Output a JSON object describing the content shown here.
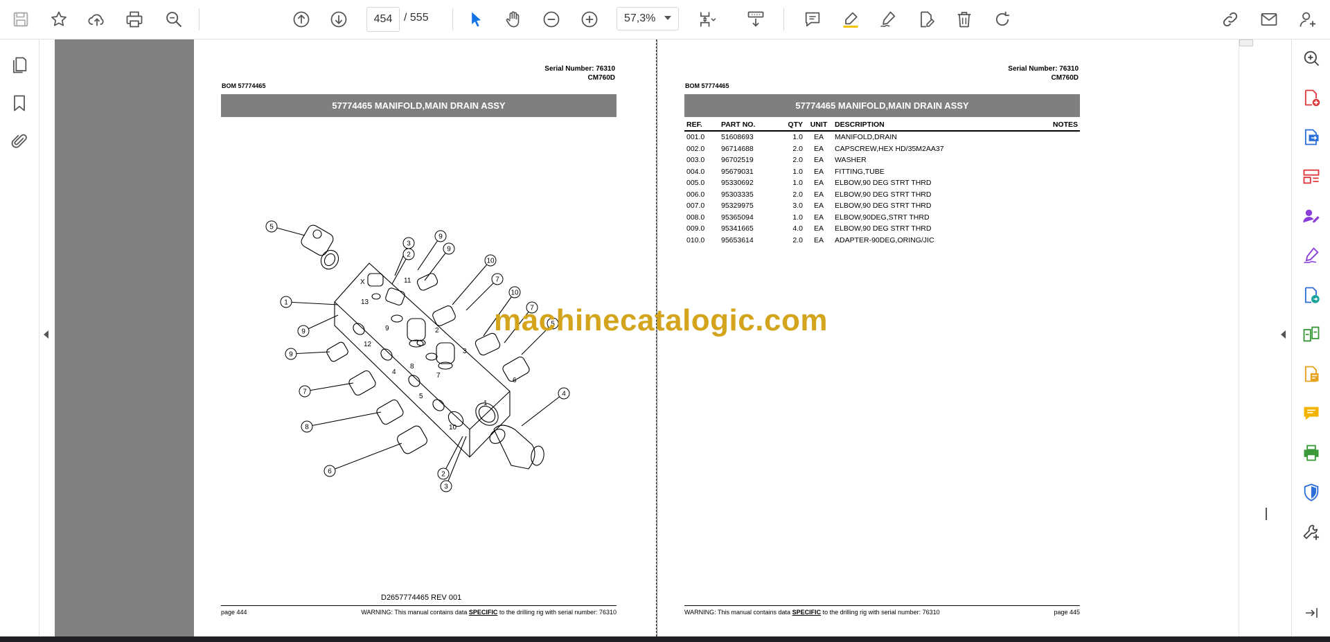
{
  "toolbar": {
    "current_page": "454",
    "total_pages": "/ 555",
    "zoom": "57,3%"
  },
  "left_page": {
    "serial": "Serial Number: 76310",
    "model": "CM760D",
    "bom": "BOM 57774465",
    "title": "57774465 MANIFOLD,MAIN DRAIN ASSY",
    "drawing_no": "D2657774465 REV 001",
    "page_label": "page 444",
    "warning_pre": "WARNING:  This manual contains data ",
    "warning_specific": "SPECIFIC",
    "warning_post": " to the drilling rig with serial number: 76310"
  },
  "right_page": {
    "serial": "Serial Number: 76310",
    "model": "CM760D",
    "bom": "BOM 57774465",
    "title": "57774465 MANIFOLD,MAIN DRAIN ASSY",
    "page_label": "page 445",
    "warning_pre": "WARNING:  This manual contains data ",
    "warning_specific": "SPECIFIC",
    "warning_post": " to the drilling rig with serial number: 76310",
    "table": {
      "headers": [
        "REF.",
        "PART NO.",
        "QTY",
        "UNIT",
        "DESCRIPTION",
        "NOTES"
      ],
      "rows": [
        [
          "001.0",
          "51608693",
          "1.0",
          "EA",
          "MANIFOLD,DRAIN",
          ""
        ],
        [
          "002.0",
          "96714688",
          "2.0",
          "EA",
          "CAPSCREW,HEX HD/35M2AA37",
          ""
        ],
        [
          "003.0",
          "96702519",
          "2.0",
          "EA",
          "WASHER",
          ""
        ],
        [
          "004.0",
          "95679031",
          "1.0",
          "EA",
          "FITTING,TUBE",
          ""
        ],
        [
          "005.0",
          "95330692",
          "1.0",
          "EA",
          "ELBOW,90 DEG STRT THRD",
          ""
        ],
        [
          "006.0",
          "95303335",
          "2.0",
          "EA",
          "ELBOW,90 DEG STRT THRD",
          ""
        ],
        [
          "007.0",
          "95329975",
          "3.0",
          "EA",
          "ELBOW,90 DEG STRT THRD",
          ""
        ],
        [
          "008.0",
          "95365094",
          "1.0",
          "EA",
          "ELBOW,90DEG,STRT THRD",
          ""
        ],
        [
          "009.0",
          "95341665",
          "4.0",
          "EA",
          "ELBOW,90 DEG STRT THRD",
          ""
        ],
        [
          "010.0",
          "95653614",
          "2.0",
          "EA",
          "ADAPTER-90DEG,ORING/JIC",
          ""
        ]
      ]
    }
  },
  "watermark": "machinecatalogic.com",
  "diagram": {
    "callouts": [
      "5",
      "3",
      "2",
      "9",
      "9",
      "10",
      "7",
      "10",
      "7",
      "5",
      "1",
      "9",
      "9",
      "7",
      "8",
      "6",
      "4",
      "2",
      "3"
    ],
    "body_labels": [
      "X",
      "13",
      "11",
      "12",
      "4",
      "5",
      "1",
      "10",
      "2",
      "3",
      "6",
      "7",
      "8",
      "9"
    ]
  },
  "icons": {
    "toolbar": [
      "save-icon",
      "star-icon",
      "upload-cloud-icon",
      "print-icon",
      "zoom-search-icon",
      "page-up-icon",
      "page-down-icon",
      "select-arrow-icon",
      "hand-icon",
      "zoom-out-icon",
      "zoom-in-icon",
      "page-fit-icon",
      "scroll-mode-icon",
      "comment-icon",
      "highlight-icon",
      "sign-icon",
      "edit-pdf-icon",
      "delete-icon",
      "rotate-icon",
      "share-link-icon",
      "email-icon",
      "account-icon"
    ],
    "left": [
      "pages-thumbnail-icon",
      "bookmark-icon",
      "attachment-icon"
    ],
    "right": [
      "zoom-icon",
      "create-pdf-icon",
      "export-pdf-icon",
      "organize-pages-icon",
      "request-signature-icon",
      "fill-sign-icon",
      "convert-pdf-icon",
      "compare-icon",
      "edit-text-icon",
      "comment-tool-icon",
      "print-production-icon",
      "protect-icon",
      "more-tools-icon",
      "expand-panel-icon"
    ]
  },
  "colors": {
    "band_gray": "#7f7f7f",
    "viewer_gray": "#808080",
    "watermark": "#d3a41c",
    "select_blue": "#1473e6"
  }
}
